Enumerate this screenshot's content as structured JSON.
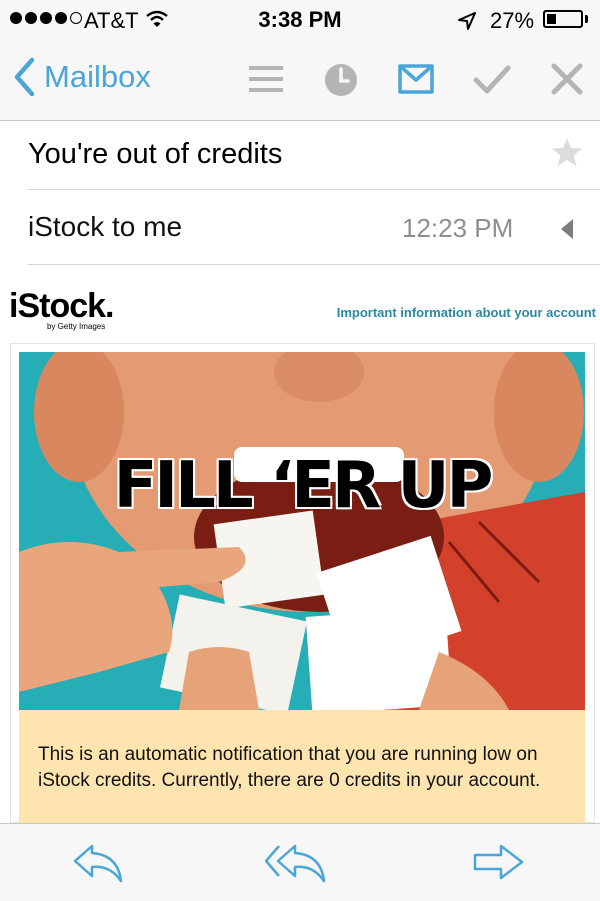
{
  "status": {
    "carrier": "AT&T",
    "time": "3:38 PM",
    "battery_pct": "27%",
    "battery_level": 0.27,
    "signal_bars_filled": 4,
    "signal_bars_total": 5
  },
  "nav": {
    "back_label": "Mailbox",
    "icons": [
      "list-icon",
      "clock-icon",
      "move-to-folder-icon",
      "checkmark-icon",
      "close-icon"
    ],
    "accent_color": "#4aa6d9"
  },
  "message": {
    "subject": "You're out of credits",
    "sender_line": "iStock to me",
    "received_time": "12:23 PM"
  },
  "email": {
    "brand_name": "iStock.",
    "brand_sub": "by Getty Images",
    "header_link": "Important information about your account",
    "hero_title": "FILL ‘ER UP",
    "notice_text": "This is an automatic notification that you are running low on iStock credits. Currently, there are 0 credits in your account.",
    "colors": {
      "hero_bg": "#26adb6",
      "notice_bg": "#fee5b0",
      "link": "#2a8aa0"
    }
  },
  "toolbar": {
    "icons": [
      "reply-icon",
      "reply-all-icon",
      "forward-icon"
    ]
  }
}
